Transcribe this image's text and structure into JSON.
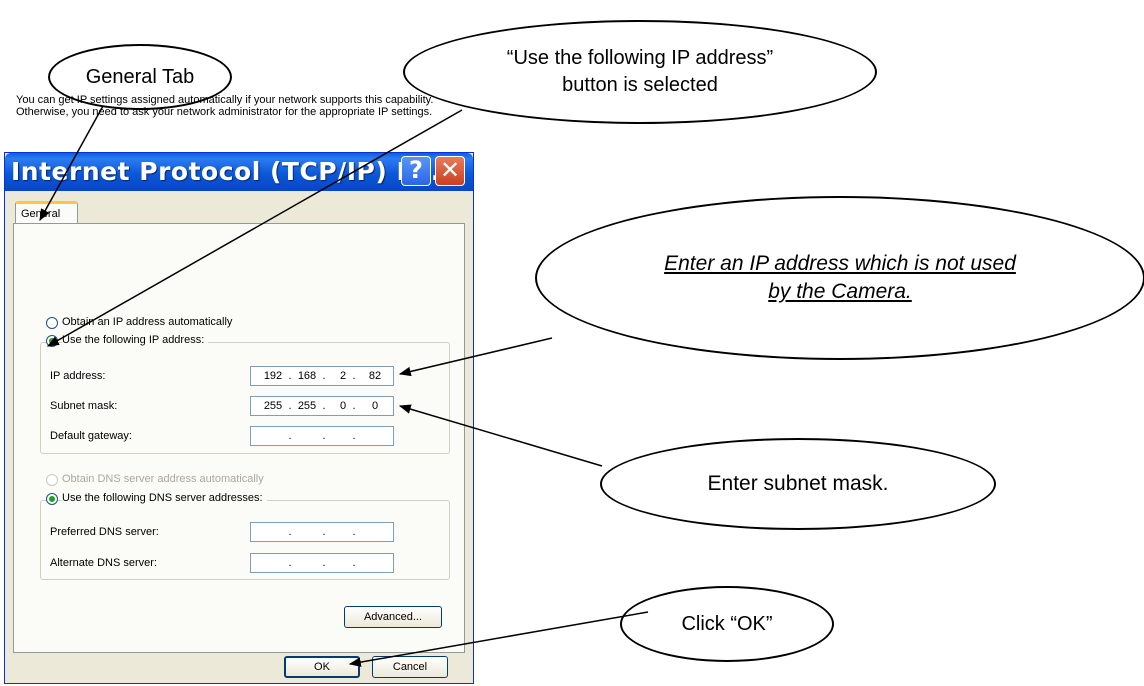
{
  "callouts": {
    "general_tab": "General Tab",
    "use_ip_line1": "“Use the following IP address”",
    "use_ip_line2": "button is selected",
    "enter_ip_line1": "Enter an IP address which is not used",
    "enter_ip_line2": "by the Camera.",
    "subnet": "Enter subnet mask.",
    "ok": "Click “OK”"
  },
  "dialog": {
    "title": "Internet Protocol (TCP/IP) P...",
    "help_glyph": "?",
    "close_glyph": "✕",
    "tab_general": "General",
    "info_text": "You can get IP settings assigned automatically if your network supports this capability. Otherwise, you need to ask your network administrator for the appropriate IP settings.",
    "radio_auto_ip": "Obtain an IP address automatically",
    "radio_use_ip": "Use the following IP address:",
    "label_ip": "IP address:",
    "ip": [
      "192",
      "168",
      "2",
      "82"
    ],
    "label_subnet": "Subnet mask:",
    "subnet": [
      "255",
      "255",
      "0",
      "0"
    ],
    "label_gateway": "Default gateway:",
    "radio_auto_dns": "Obtain DNS server address automatically",
    "radio_use_dns": "Use the following DNS server addresses:",
    "label_pref_dns": "Preferred DNS server:",
    "label_alt_dns": "Alternate DNS server:",
    "separator": ".",
    "advanced": "Advanced...",
    "ok": "OK",
    "cancel": "Cancel"
  }
}
